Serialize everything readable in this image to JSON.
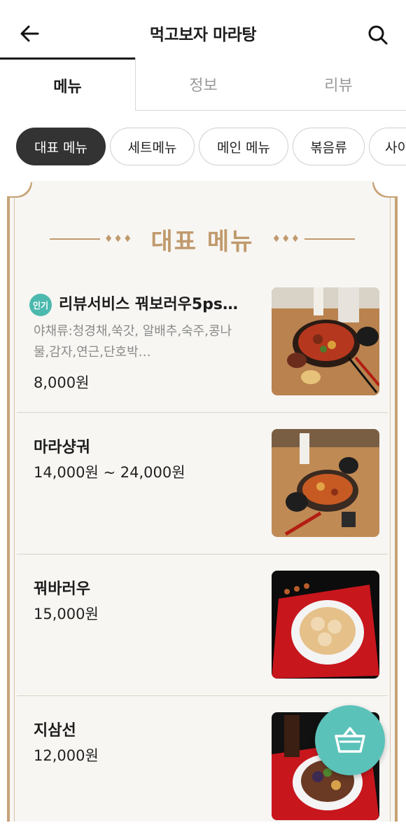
{
  "header": {
    "title": "먹고보자 마라탕",
    "back_icon": "arrow-left-icon",
    "search_icon": "search-icon"
  },
  "tabs": [
    {
      "label": "메뉴",
      "active": true
    },
    {
      "label": "정보",
      "active": false
    },
    {
      "label": "리뷰",
      "active": false
    }
  ],
  "categories": [
    {
      "label": "대표 메뉴",
      "active": true
    },
    {
      "label": "세트메뉴",
      "active": false
    },
    {
      "label": "메인 메뉴",
      "active": false
    },
    {
      "label": "볶음류",
      "active": false
    },
    {
      "label": "사이",
      "active": false
    }
  ],
  "section": {
    "title": "대표 메뉴",
    "ornament_left": "♦♦♦",
    "ornament_right": "♦♦♦"
  },
  "items": [
    {
      "badge": "인기",
      "name": "리뷰서비스 꿔보러우5ps…",
      "description": "야채류:청경채,쑥갓, 알배추,숙주,콩나물,감자,연근,단호박…",
      "price": "8,000원"
    },
    {
      "name": "마라샹궈",
      "price": "14,000원 ~ 24,000원"
    },
    {
      "name": "꿔바러우",
      "price": "15,000원"
    },
    {
      "name": "지삼선",
      "price": "12,000원"
    }
  ],
  "colors": {
    "accent_gold": "#c09a6d",
    "teal": "#5bc2b9",
    "chip_active": "#333333"
  },
  "cart": {
    "icon": "shopping-basket-icon"
  }
}
